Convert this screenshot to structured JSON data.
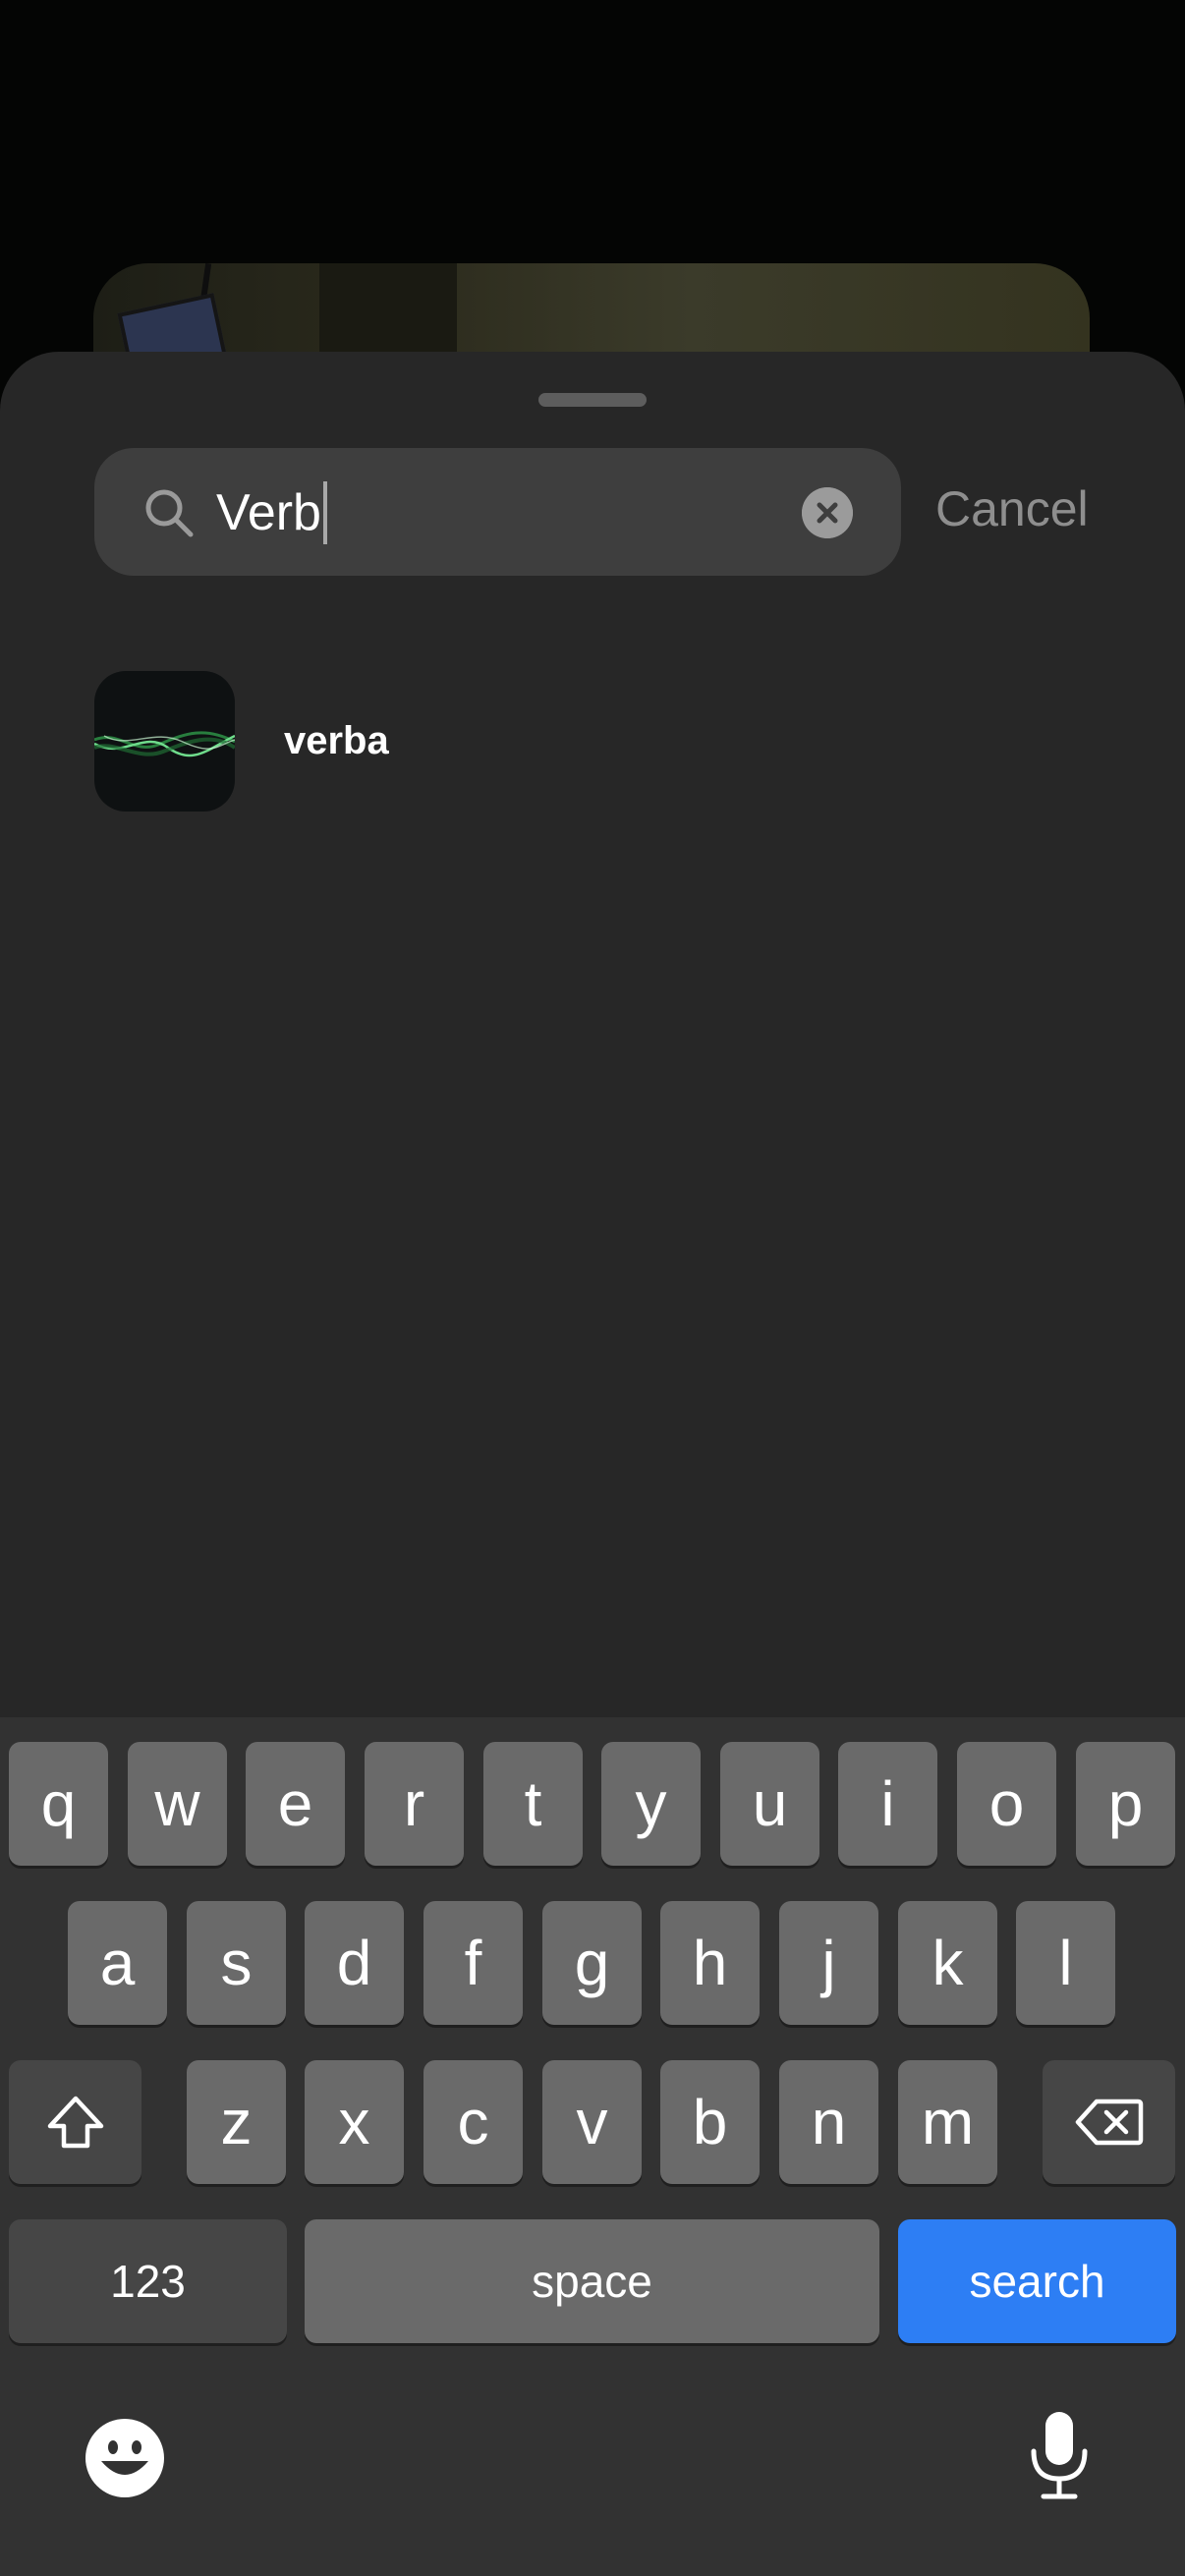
{
  "search": {
    "query": "Verb",
    "cancel_label": "Cancel"
  },
  "results": [
    {
      "name": "verba",
      "icon": "waveform-app-icon"
    }
  ],
  "keyboard": {
    "row1": [
      "q",
      "w",
      "e",
      "r",
      "t",
      "y",
      "u",
      "i",
      "o",
      "p"
    ],
    "row2": [
      "a",
      "s",
      "d",
      "f",
      "g",
      "h",
      "j",
      "k",
      "l"
    ],
    "row3": [
      "z",
      "x",
      "c",
      "v",
      "b",
      "n",
      "m"
    ],
    "numbers_label": "123",
    "space_label": "space",
    "return_label": "search",
    "icons": {
      "shift": "shift-icon",
      "delete": "backspace-icon",
      "emoji": "emoji-icon",
      "dictation": "microphone-icon"
    }
  },
  "colors": {
    "sheet": "#272727",
    "search_field": "#3e3e3e",
    "key": "#6a6a6a",
    "key_dark": "#464646",
    "accent": "#2d7ef4"
  }
}
